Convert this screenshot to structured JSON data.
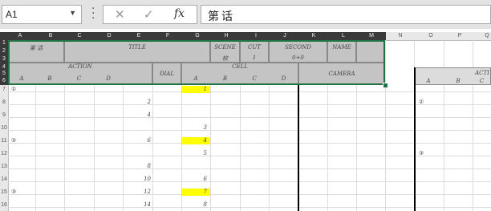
{
  "formula_bar": {
    "name_box": "A1",
    "cancel_icon": "✕",
    "enter_icon": "✓",
    "fx_label": "fx",
    "content": "第话"
  },
  "columns": [
    "A",
    "B",
    "C",
    "D",
    "E",
    "F",
    "G",
    "H",
    "I",
    "J",
    "K",
    "L",
    "M",
    "N",
    "O",
    "P",
    "Q"
  ],
  "rows": [
    "1",
    "2",
    "3",
    "4",
    "5",
    "6",
    "7",
    "8",
    "9",
    "10",
    "11",
    "12",
    "13",
    "14",
    "15",
    "16",
    "17",
    "18",
    "19",
    "20",
    "21",
    "22"
  ],
  "header": {
    "episode": "第 话",
    "title": "TITLE",
    "scene": "SCENE",
    "cut": "CUT",
    "second": "SECOND",
    "name": "NAME",
    "scene_val": "校",
    "cut_val": "1",
    "second_val": "0+0",
    "action": "ACTION",
    "dial": "DIAL",
    "cell": "CELL",
    "camera": "CAMERA",
    "action_cols": [
      "A",
      "B",
      "C",
      "D"
    ],
    "cell_cols": [
      "A",
      "B",
      "C",
      "D"
    ],
    "right_action": "ACTI",
    "right_cols": [
      "A",
      "B",
      "C"
    ]
  },
  "frames": [
    "2",
    "4",
    "6",
    "8",
    "10",
    "12",
    "14"
  ],
  "cell_a": [
    "1",
    "3",
    "4",
    "5",
    "6",
    "7",
    "8"
  ],
  "markers": [
    "①",
    "②",
    "③"
  ],
  "right_markers": [
    "②",
    "③"
  ]
}
